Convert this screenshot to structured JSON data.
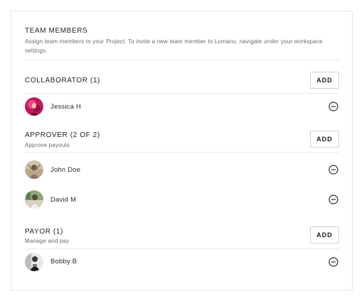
{
  "header": {
    "title": "TEAM MEMBERS",
    "subtitle": "Assign team members to your Project. To invite a new team member to Lumanu, navigate under your workspace settings."
  },
  "sections": [
    {
      "title": "COLLABORATOR (1)",
      "subtitle": "",
      "add_label": "ADD",
      "members": [
        {
          "name": "Jessica  H",
          "avatar_icon": "avatar-photo"
        }
      ]
    },
    {
      "title": "APPROVER (2 OF 2)",
      "subtitle": "Approve payouts",
      "add_label": "ADD",
      "members": [
        {
          "name": "John Doe",
          "avatar_icon": "avatar-photo"
        },
        {
          "name": "David M",
          "avatar_icon": "avatar-photo"
        }
      ]
    },
    {
      "title": "PAYOR (1)",
      "subtitle": "Manage and pay",
      "add_label": "ADD",
      "members": [
        {
          "name": "Bobby B",
          "avatar_icon": "avatar-photo"
        }
      ]
    }
  ],
  "icons": {
    "remove": "minus-circle-icon"
  },
  "colors": {
    "text": "#222222",
    "muted": "#6b6b6b",
    "border": "#e6e6e6"
  }
}
